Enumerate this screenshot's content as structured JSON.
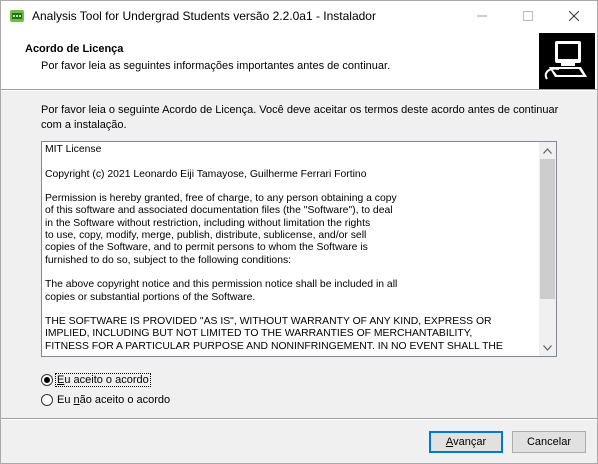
{
  "window": {
    "title": "Analysis Tool for Undergrad Students versão 2.2.0a1 - Instalador"
  },
  "header": {
    "title": "Acordo de Licença",
    "subtitle": "Por favor leia as seguintes informações importantes antes de continuar."
  },
  "intro": {
    "line1": "Por favor leia o seguinte Acordo de Licença. Você deve aceitar os termos deste acordo antes de continuar",
    "line2": "com a instalação."
  },
  "license": {
    "lines": [
      "MIT License",
      "",
      "Copyright (c) 2021 Leonardo Eiji Tamayose, Guilherme Ferrari Fortino",
      "",
      "Permission is hereby granted, free of charge, to any person obtaining a copy",
      "of this software and associated documentation files (the \"Software\"), to deal",
      "in the Software without restriction, including without limitation the rights",
      "to use, copy, modify, merge, publish, distribute, sublicense, and/or sell",
      "copies of the Software, and to permit persons to whom the Software is",
      "furnished to do so, subject to the following conditions:",
      "",
      "The above copyright notice and this permission notice shall be included in all",
      "copies or substantial portions of the Software.",
      "",
      "THE SOFTWARE IS PROVIDED \"AS IS\", WITHOUT WARRANTY OF ANY KIND, EXPRESS OR",
      "IMPLIED, INCLUDING BUT NOT LIMITED TO THE WARRANTIES OF MERCHANTABILITY,",
      "FITNESS FOR A PARTICULAR PURPOSE AND NONINFRINGEMENT. IN NO EVENT SHALL THE"
    ]
  },
  "options": {
    "accept": {
      "prefix": "",
      "underlined": "E",
      "rest": "u aceito o acordo",
      "checked": true
    },
    "decline": {
      "prefix": "Eu ",
      "underlined": "n",
      "rest": "ão aceito o acordo",
      "checked": false
    }
  },
  "buttons": {
    "next": {
      "underlined": "A",
      "rest": "vançar"
    },
    "cancel": "Cancelar"
  }
}
